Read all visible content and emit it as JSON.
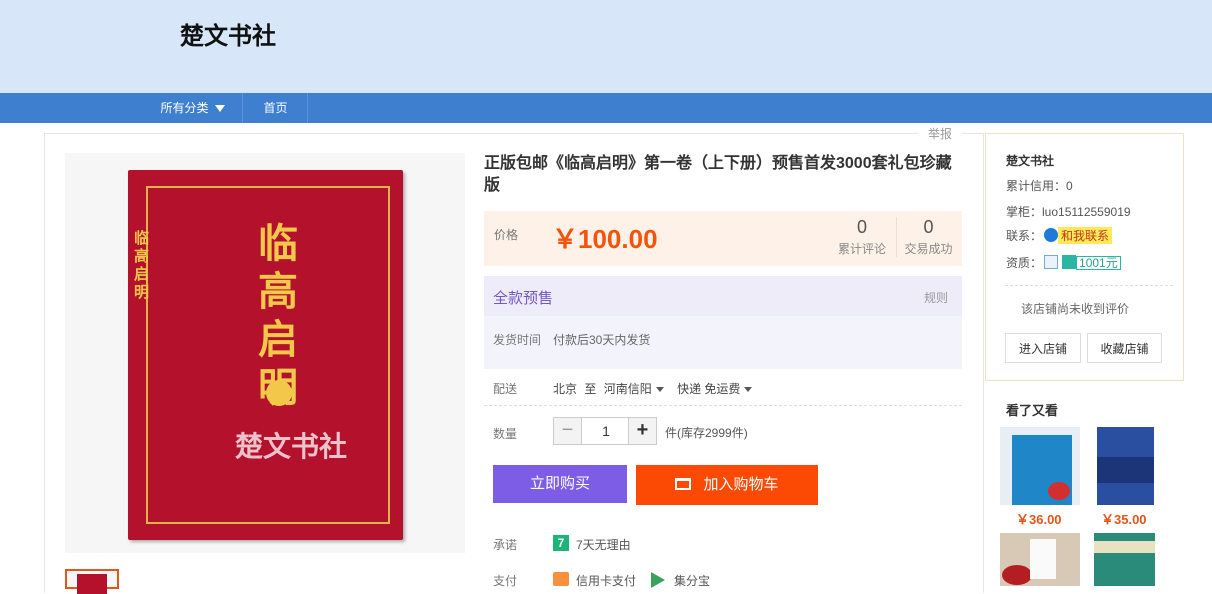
{
  "header": {
    "shop_title": "楚文书社"
  },
  "nav": {
    "categories": "所有分类",
    "home": "首页"
  },
  "report": "举报",
  "product": {
    "watermark": "楚文书社",
    "book_cover_title": "临高启明",
    "title": "正版包邮《临高启明》第一卷（上下册）预售首发3000套礼包珍藏版",
    "price_label": "价格",
    "price": "￥100.00",
    "stats": [
      {
        "value": "0",
        "label": "累计评论"
      },
      {
        "value": "0",
        "label": "交易成功"
      }
    ],
    "presale": {
      "title": "全款预售",
      "rule": "规则",
      "ship_label": "发货时间",
      "ship_value": "付款后30天内发货"
    },
    "delivery": {
      "label": "配送",
      "from": "北京",
      "to_word": "至",
      "to": "河南信阳",
      "method": "快递 免运费"
    },
    "quantity": {
      "label": "数量",
      "value": "1",
      "stock": "件(库存2999件)"
    },
    "buttons": {
      "buy_now": "立即购买",
      "add_cart": "加入购物车"
    },
    "promise": {
      "label": "承诺",
      "icon_text": "7",
      "text": "7天无理由"
    },
    "payment": {
      "label": "支付",
      "credit": "信用卡支付",
      "jifen": "集分宝"
    }
  },
  "seller": {
    "name": "楚文书社",
    "credit_label": "累计信用：",
    "credit_value": "0",
    "account_label": "掌柜：",
    "account_value": "luo15112559019",
    "contact_label": "联系：",
    "contact_button": "和我联系",
    "qualification_label": "资质：",
    "coin_value": "1001元",
    "no_review": "该店铺尚未收到评价",
    "enter_shop": "进入店铺",
    "favorite_shop": "收藏店铺"
  },
  "recommend": {
    "title": "看了又看",
    "items": [
      {
        "price": "￥36.00"
      },
      {
        "price": "￥35.00"
      }
    ]
  },
  "colors": {
    "header_bg": "#d7e6f8",
    "nav_bg": "#3f7fd0",
    "price": "#f2540c",
    "buy_button": "#7d5de6",
    "cart_button": "#fc4a05"
  }
}
